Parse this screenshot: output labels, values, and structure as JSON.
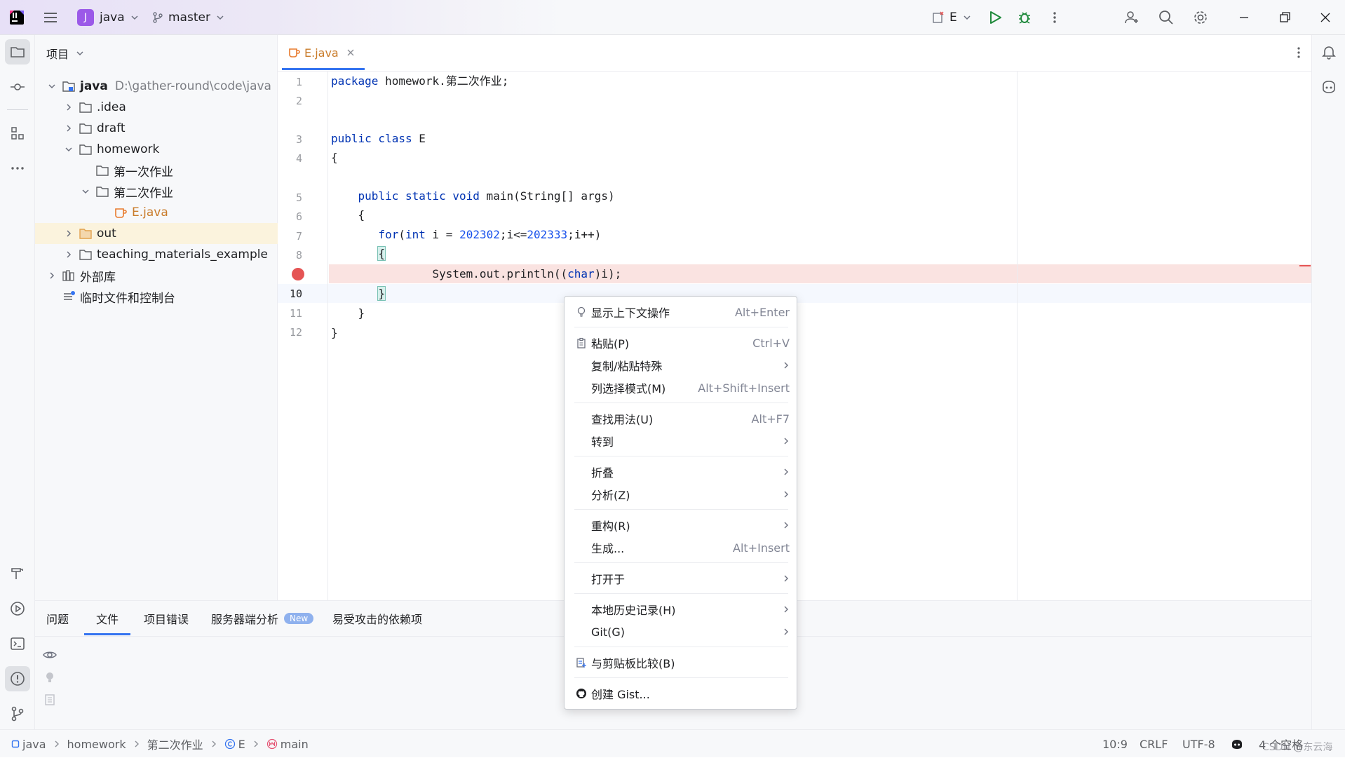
{
  "titlebar": {
    "project_badge": "J",
    "project_name": "java",
    "branch": "master",
    "run_config": "E"
  },
  "leftbar": {
    "icons": [
      "folder-icon",
      "commit-icon",
      "structure-icon",
      "more-icon",
      "build-icon",
      "run-icon",
      "terminal-icon",
      "problems-icon",
      "git-icon"
    ]
  },
  "project_panel": {
    "title": "项目",
    "tree": [
      {
        "label": "java",
        "path": "D:\\gather-round\\code\\java"
      },
      {
        "label": ".idea"
      },
      {
        "label": "draft"
      },
      {
        "label": "homework"
      },
      {
        "label": "第一次作业"
      },
      {
        "label": "第二次作业"
      },
      {
        "label": "E.java"
      },
      {
        "label": "out"
      },
      {
        "label": "teaching_materials_example"
      },
      {
        "label": "外部库"
      },
      {
        "label": "临时文件和控制台"
      }
    ]
  },
  "editor": {
    "tab": "E.java",
    "line_numbers": [
      "1",
      "2",
      "3",
      "4",
      "5",
      "6",
      "7",
      "8",
      "",
      "10",
      "11",
      "12"
    ],
    "code": {
      "l1_kw": "package",
      "l1_rest": " homework.第二次作业;",
      "l3_kw": "public class",
      "l3_rest": " E",
      "l4": "{",
      "l5_indent": "    ",
      "l5_kw": "public static void",
      "l5_rest": " main(String[] args)",
      "l6": "    {",
      "l7_indent": "       ",
      "l7_for": "for",
      "l7_open": "(",
      "l7_int": "int",
      "l7_mid": " i = ",
      "l7_n1": "202302",
      "l7_mid2": ";i<=",
      "l7_n2": "202333",
      "l7_end": ";i++)",
      "l8_indent": "       ",
      "l8_brace": "{",
      "l9_indent": "               ",
      "l9_pre": "System.out.println((",
      "l9_kw": "char",
      "l9_post": ")i);",
      "l10_indent": "       ",
      "l10_brace": "}",
      "l11": "    }",
      "l12": "}"
    }
  },
  "context_menu": {
    "items": [
      {
        "label": "显示上下文操作",
        "shortcut": "Alt+Enter"
      },
      {
        "label": "粘贴(P)",
        "shortcut": "Ctrl+V"
      },
      {
        "label": "复制/粘贴特殊"
      },
      {
        "label": "列选择模式(M)",
        "shortcut": "Alt+Shift+Insert"
      },
      {
        "label": "查找用法(U)",
        "shortcut": "Alt+F7"
      },
      {
        "label": "转到"
      },
      {
        "label": "折叠"
      },
      {
        "label": "分析(Z)"
      },
      {
        "label": "重构(R)"
      },
      {
        "label": "生成...",
        "shortcut": "Alt+Insert"
      },
      {
        "label": "打开于"
      },
      {
        "label": "本地历史记录(H)"
      },
      {
        "label": "Git(G)"
      },
      {
        "label": "与剪贴板比较(B)"
      },
      {
        "label": "创建 Gist..."
      }
    ]
  },
  "bottom_panel": {
    "tabs": [
      "问题",
      "文件",
      "项目错误",
      "服务器端分析",
      "易受攻击的依赖项"
    ],
    "new_badge": "New",
    "active_tab": "文件"
  },
  "statusbar": {
    "breadcrumb": [
      "java",
      "homework",
      "第二次作业",
      "E",
      "main"
    ],
    "position": "10:9",
    "line_sep": "CRLF",
    "encoding": "UTF-8",
    "indent": "4 个空格",
    "watermark": "CSDN @东云海"
  },
  "colors": {
    "accent": "#3574f0",
    "breakpoint": "#e55454",
    "selected_row": "#fbf3dd",
    "badge": "#9b59e8"
  }
}
